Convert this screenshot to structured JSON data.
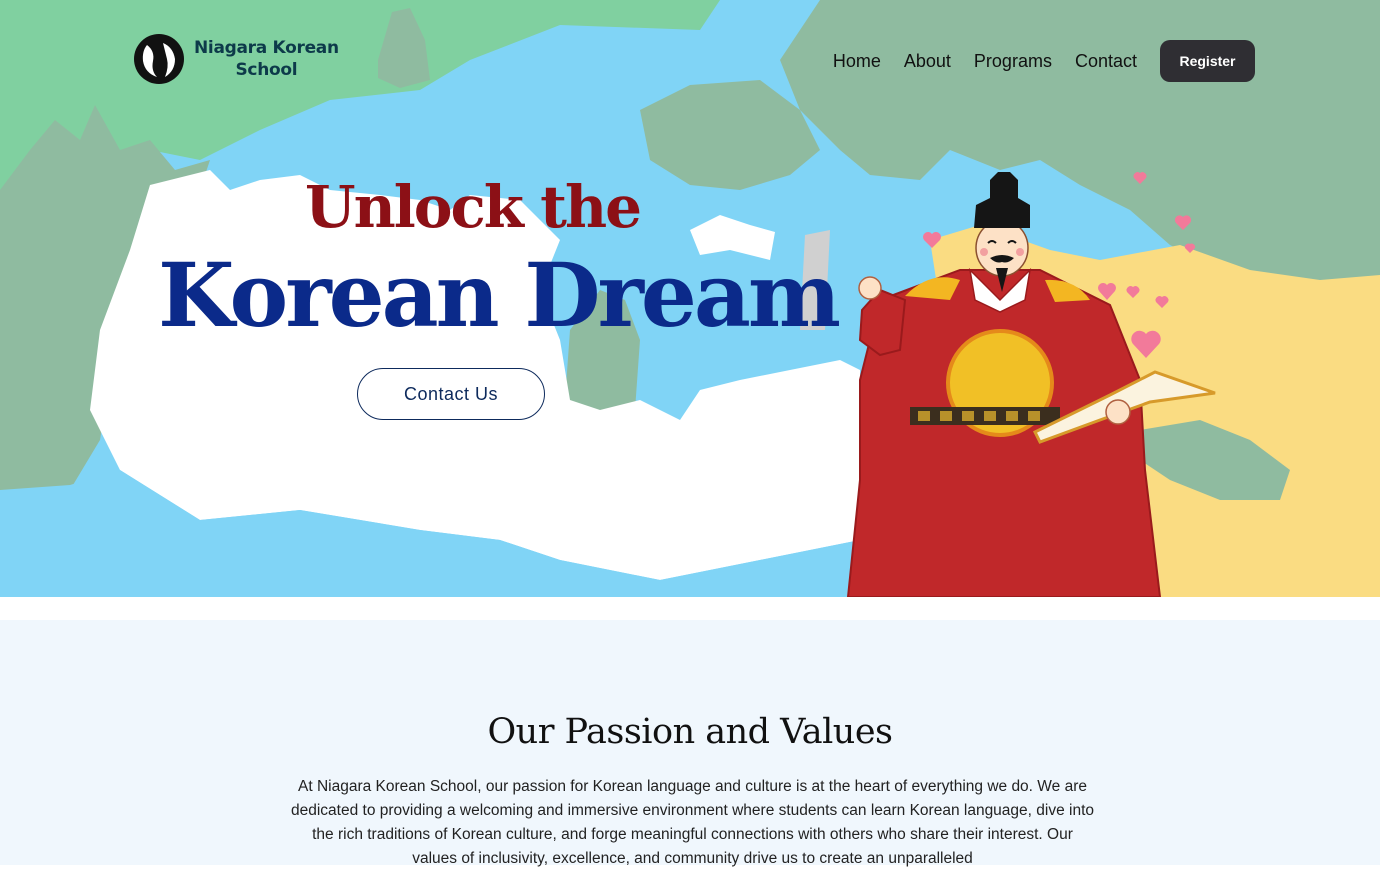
{
  "header": {
    "logo": {
      "line1": "Niagara Korean",
      "line2": "School"
    },
    "nav": [
      "Home",
      "About",
      "Programs",
      "Contact"
    ],
    "register_label": "Register"
  },
  "hero": {
    "headline_line1": "Unlock the",
    "headline_line2": "Korean Dream",
    "cta_label": "Contact Us",
    "colors": {
      "headline_line1": "#8c1016",
      "headline_line2": "#0b2a8a"
    }
  },
  "values_section": {
    "title": "Our Passion and Values",
    "body": "At Niagara Korean School, our passion for Korean language and culture is at the heart of everything we do. We are dedicated to providing a welcoming and immersive environment where students can learn Korean language, dive into the rich traditions of Korean culture, and forge meaningful connections with others who share their interest. Our values of inclusivity, excellence, and community drive us to create an unparalleled"
  }
}
